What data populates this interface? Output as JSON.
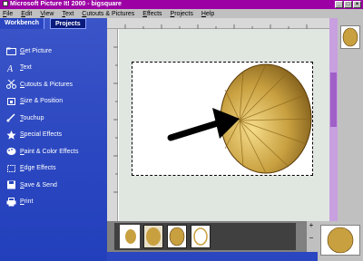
{
  "window": {
    "title": "Microsoft Picture It! 2000 - bigsquare",
    "minimize": "_",
    "maximize": "□",
    "close": "×"
  },
  "menu": [
    "File",
    "Edit",
    "View",
    "Text",
    "Cutouts & Pictures",
    "Effects",
    "Projects",
    "Help"
  ],
  "sidebar": {
    "tabs": [
      "Workbench",
      "Projects"
    ],
    "items": [
      {
        "label": "Get Picture",
        "icon": "folder-icon"
      },
      {
        "label": "Text",
        "icon": "text-a-icon"
      },
      {
        "label": "Cutouts & Pictures",
        "icon": "scissors-icon"
      },
      {
        "label": "Size & Position",
        "icon": "resize-icon"
      },
      {
        "label": "Touchup",
        "icon": "brush-icon"
      },
      {
        "label": "Special Effects",
        "icon": "star-icon"
      },
      {
        "label": "Paint & Color Effects",
        "icon": "palette-icon"
      },
      {
        "label": "Edge Effects",
        "icon": "edge-icon"
      },
      {
        "label": "Save & Send",
        "icon": "disk-icon"
      },
      {
        "label": "Print",
        "icon": "printer-icon"
      }
    ]
  },
  "zoom": {
    "in": "+",
    "out": "−"
  },
  "colors": {
    "titlebar": "#9c00a4",
    "sidebar": "#2a46c0",
    "gold": "#c8a040"
  }
}
